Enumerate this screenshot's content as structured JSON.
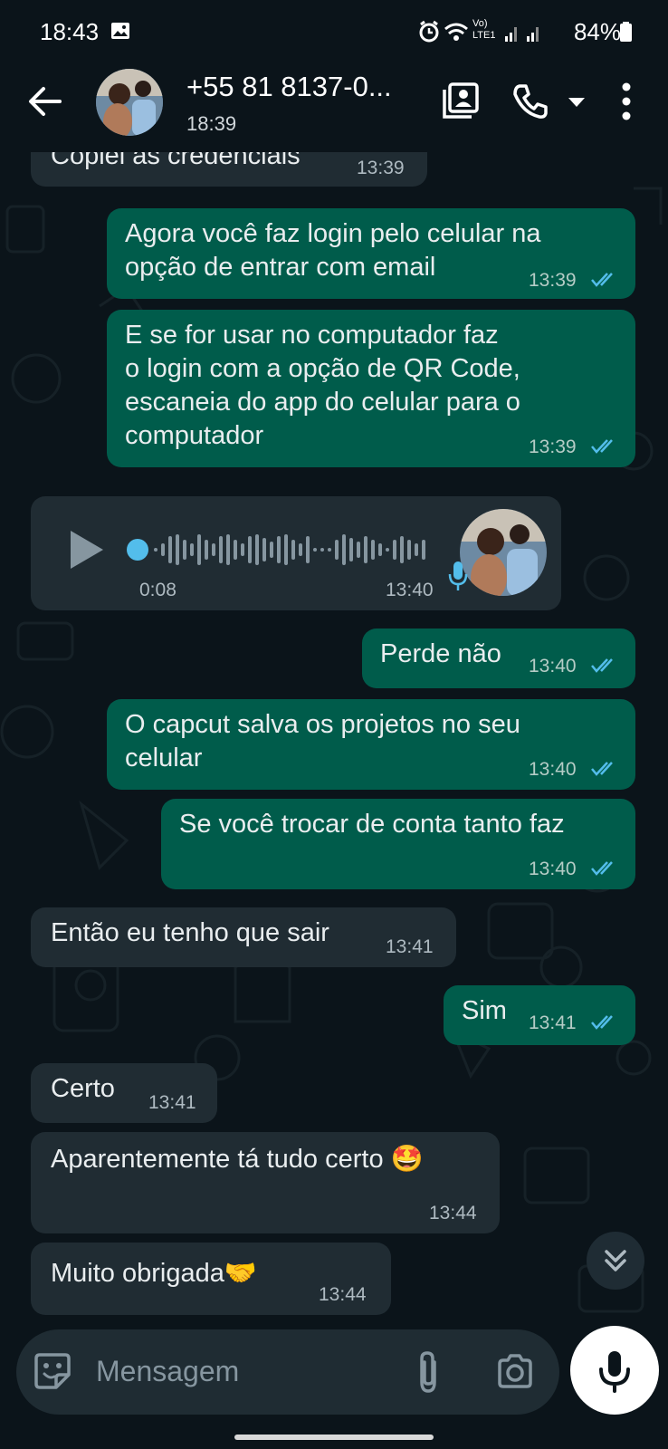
{
  "status_bar": {
    "time": "18:43",
    "net_label": "Vo) LTE1",
    "battery": "84%"
  },
  "header": {
    "contact": "+55 81 8137-0...",
    "subtitle": "18:39",
    "icons": [
      "back-arrow-icon",
      "avatar",
      "contact-card-icon",
      "phone-icon",
      "dropdown-icon",
      "more-icon"
    ]
  },
  "messages": [
    {
      "dir": "in",
      "text": "Copiei as credenciais",
      "time": "13:39"
    },
    {
      "dir": "out",
      "lines": [
        "Agora você faz login pelo celular na",
        "opção de entrar com email"
      ],
      "time": "13:39",
      "read": true
    },
    {
      "dir": "out",
      "lines": [
        "E se for usar no computador faz",
        "o login com a opção de QR Code,",
        "escaneia do app do celular para o",
        "computador"
      ],
      "time": "13:39",
      "read": true
    },
    {
      "dir": "in",
      "type": "voice",
      "duration": "0:08",
      "time": "13:40"
    },
    {
      "dir": "out",
      "text": "Perde não",
      "time": "13:40",
      "read": true
    },
    {
      "dir": "out",
      "lines": [
        "O capcut salva os projetos no seu",
        "celular"
      ],
      "time": "13:40",
      "read": true
    },
    {
      "dir": "out",
      "text": "Se você trocar de conta tanto faz",
      "time": "13:40",
      "read": true
    },
    {
      "dir": "in",
      "text": "Então eu tenho que sair",
      "time": "13:41"
    },
    {
      "dir": "out",
      "text": "Sim",
      "time": "13:41",
      "read": true
    },
    {
      "dir": "in",
      "text": "Certo",
      "time": "13:41"
    },
    {
      "dir": "in",
      "text": "Aparentemente tá tudo certo 🤩",
      "time": "13:44"
    },
    {
      "dir": "in",
      "text": "Muito obrigada🤝",
      "time": "13:44"
    }
  ],
  "composer": {
    "placeholder": "Mensagem"
  },
  "colors": {
    "background": "#0b141a",
    "outgoing_bubble": "#005c4b",
    "incoming_bubble": "#202c33",
    "read_tick": "#53bdeb"
  }
}
